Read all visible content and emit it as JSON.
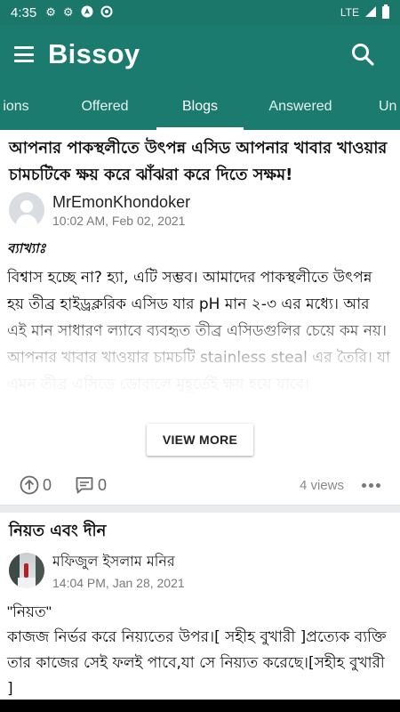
{
  "status_bar": {
    "time": "4:35",
    "network": "LTE",
    "icons": [
      "gear-icon",
      "gear-icon",
      "navigation-icon",
      "sync-icon",
      "signal-icon",
      "battery-icon"
    ]
  },
  "app_bar": {
    "title": "Bissoy",
    "menu_icon": "hamburger-menu-icon",
    "search_icon": "search-icon"
  },
  "tabs": [
    {
      "label": "ions",
      "active": false
    },
    {
      "label": "Offered",
      "active": false
    },
    {
      "label": "Blogs",
      "active": true
    },
    {
      "label": "Answered",
      "active": false
    },
    {
      "label": "Un",
      "active": false
    }
  ],
  "colors": {
    "primary": "#1b7b6e",
    "status_bar": "#1a776a"
  },
  "posts": [
    {
      "title": "আপনার পাকস্থলীতে উৎপন্ন এসিড আপনার খাবার খাওয়ার চামচটিকে ক্ষয় করে ঝাঁঝরা করে দিতে সক্ষম!",
      "author": "MrEmonKhondoker",
      "date": "10:02 AM, Feb 02, 2021",
      "label": "ব্যাখ্যাঃ",
      "body": " বিশ্বাস হচ্ছে না? হ্যা, এটি সম্ভব। আমাদের পাকস্থলীতে উৎপন্ন হয় তীব্র হাইড্রক্লরিক এসিড যার pH মান ২-৩ এর মধ্যে। আর এই মান সাধারণ ল্যাবে ব্যবহৃত তীব্র এসিডগুলির চেয়ে কম নয়। আপনার খাবার খাওয়ার চামচটি stainless steal এর তৈরি। যা এমন তীব্র এসিডে ডোবালে মুহূর্তেই ক্ষয় হয়ে যাবে।",
      "view_more": "VIEW MORE",
      "upvotes": "0",
      "comments": "0",
      "views": "4 views"
    },
    {
      "title": "নিয়ত এবং দীন",
      "author": "মফিজুল ইসলাম মনির",
      "date": "14:04 PM, Jan 28, 2021",
      "body_line1": "\"নিয়ত\"",
      "body_line2": "  কাজজ নির্ভর করে নিয়্যতের উপর।[ সহীহ বুখারী ]প্রত্যেক ব্যক্তি তার কাজের সেই ফলই পাবে,যা সে নিয়্যত করেছে।[সহীহ বুখারী ]"
    }
  ]
}
